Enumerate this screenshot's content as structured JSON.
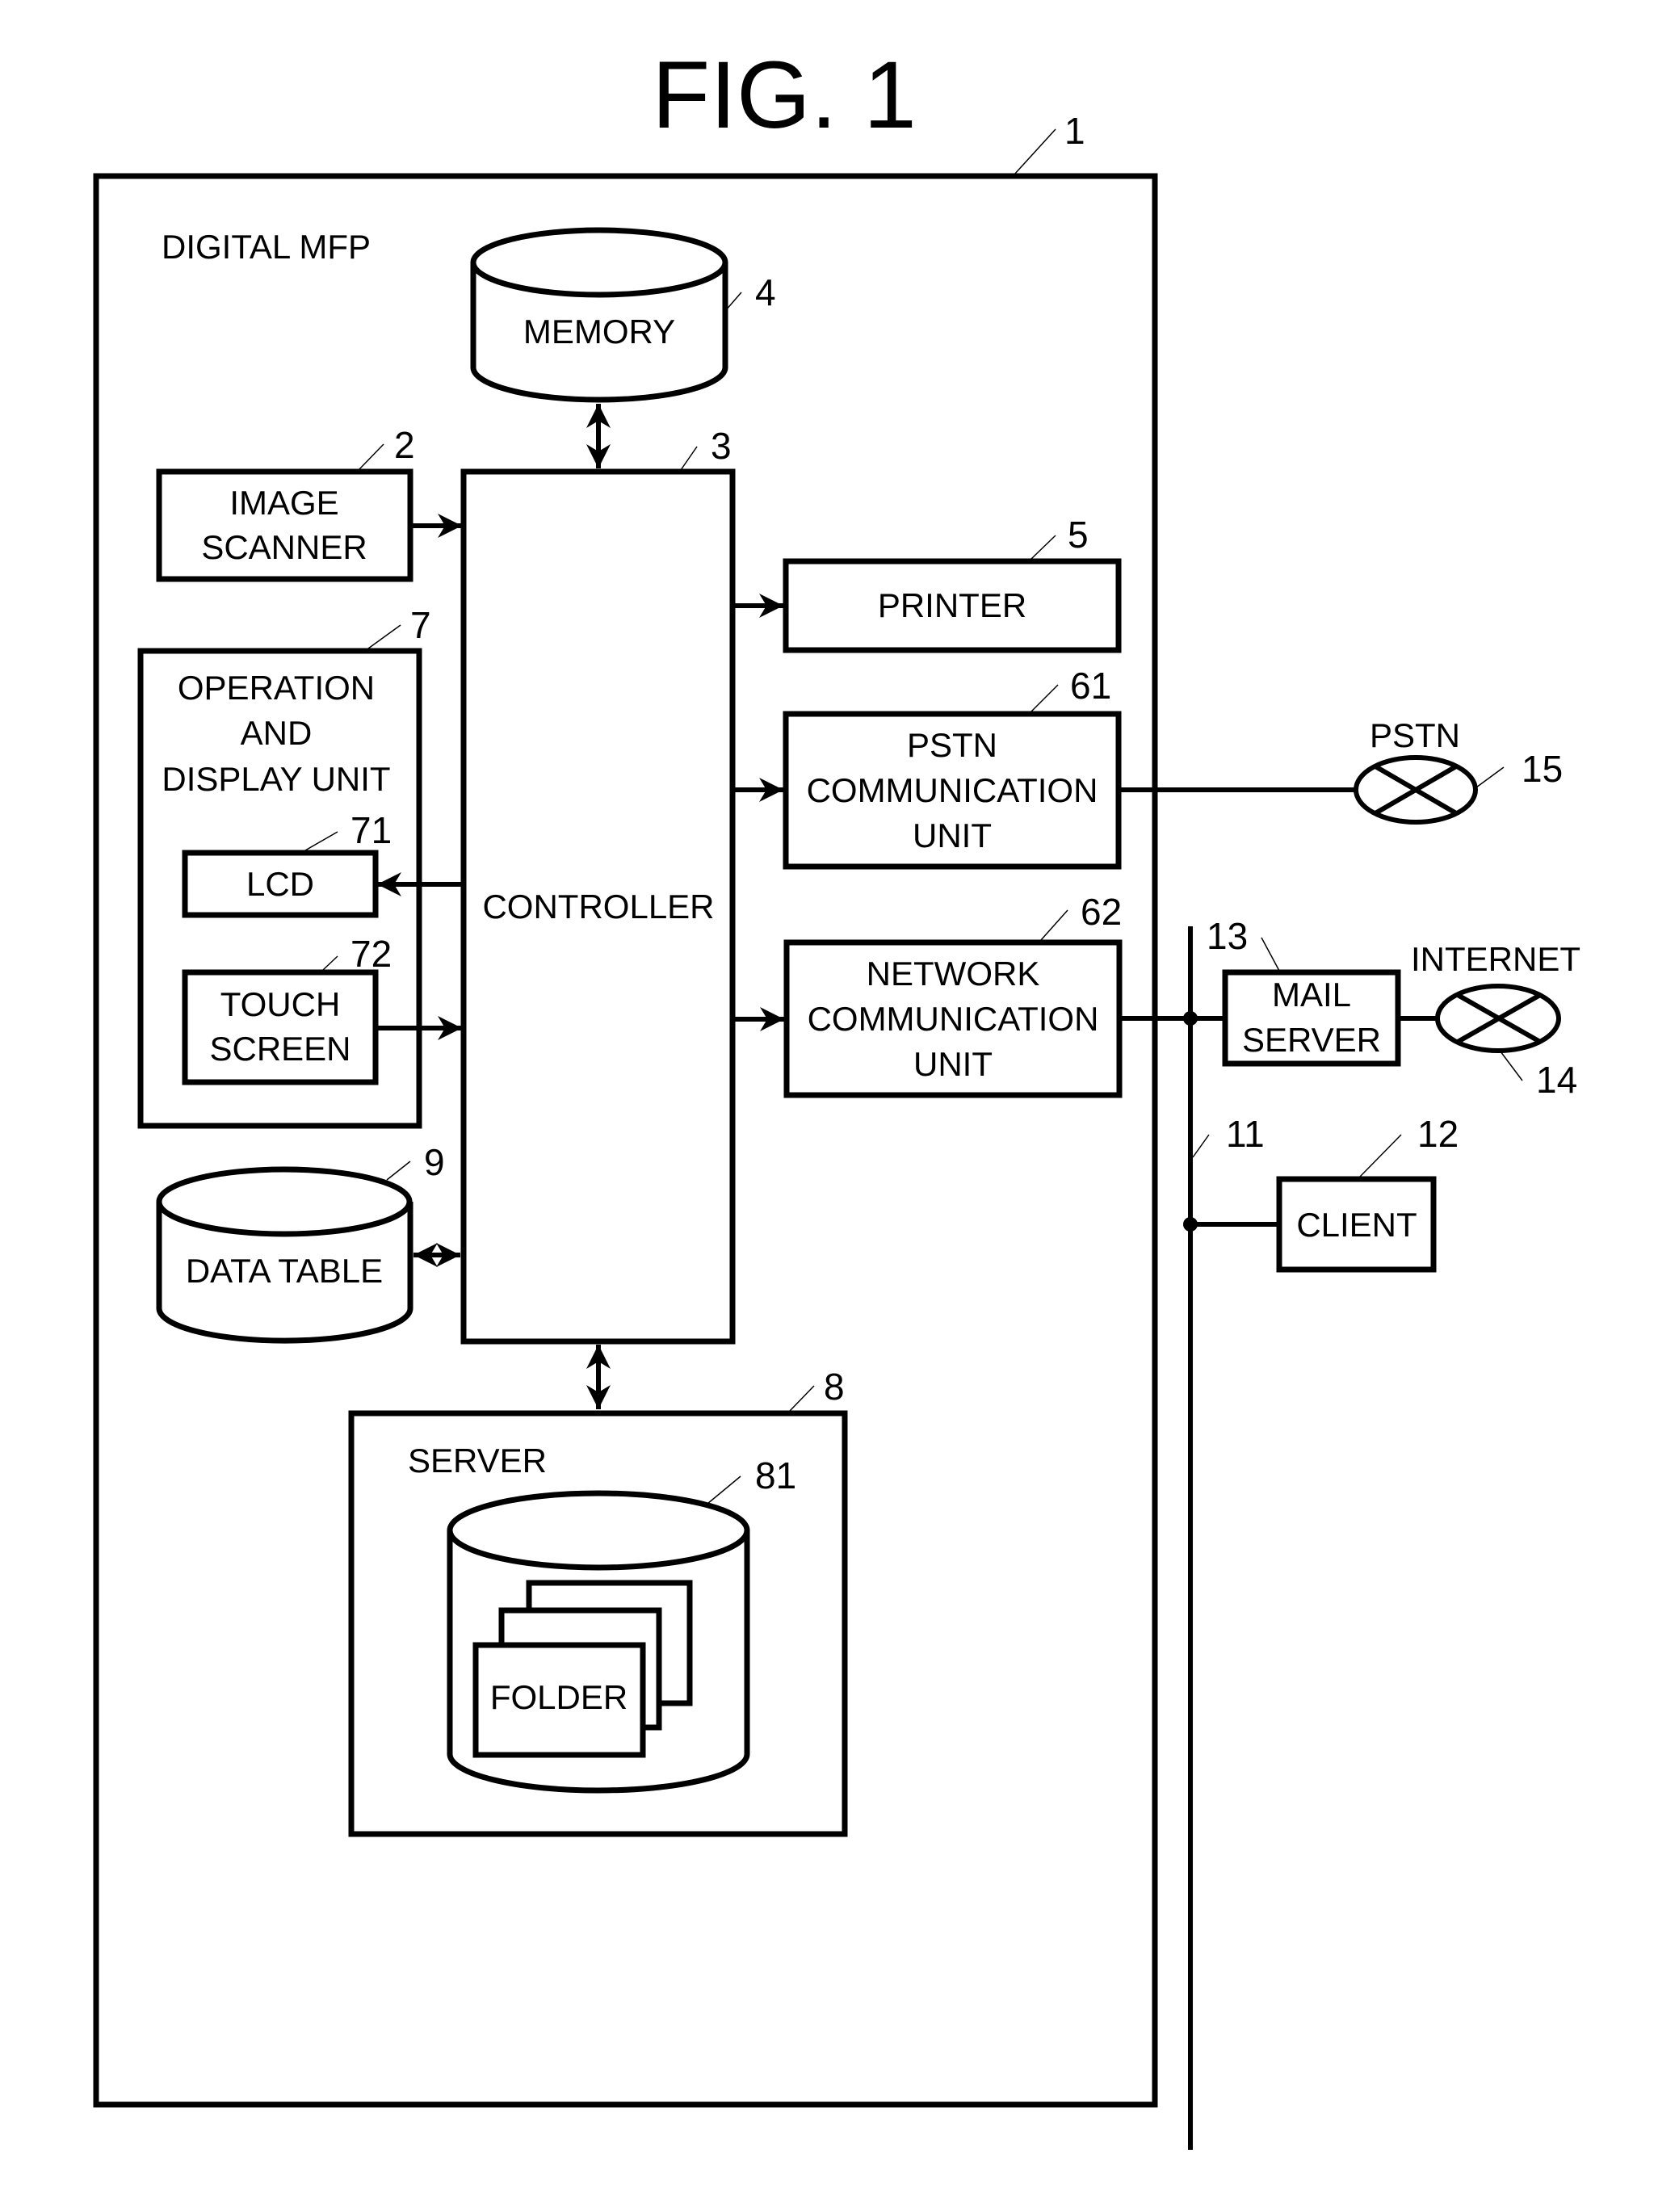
{
  "figure": {
    "title": "FIG. 1"
  },
  "mfp": {
    "ref": "1",
    "label": "DIGITAL MFP"
  },
  "components": {
    "memory": {
      "ref": "4",
      "label": "MEMORY"
    },
    "image_scanner": {
      "ref": "2",
      "lines": [
        "IMAGE",
        "SCANNER"
      ]
    },
    "controller": {
      "ref": "3",
      "label": "CONTROLLER"
    },
    "printer": {
      "ref": "5",
      "label": "PRINTER"
    },
    "pstn_comm_unit": {
      "ref": "61",
      "lines": [
        "PSTN",
        "COMMUNICATION",
        "UNIT"
      ]
    },
    "network_comm_unit": {
      "ref": "62",
      "lines": [
        "NETWORK",
        "COMMUNICATION",
        "UNIT"
      ]
    },
    "operation_display_unit": {
      "ref": "7",
      "lines": [
        "OPERATION",
        "AND",
        "DISPLAY UNIT"
      ]
    },
    "lcd": {
      "ref": "71",
      "label": "LCD"
    },
    "touch_screen": {
      "ref": "72",
      "lines": [
        "TOUCH",
        "SCREEN"
      ]
    },
    "data_table": {
      "ref": "9",
      "label": "DATA TABLE"
    },
    "server": {
      "ref": "8",
      "label": "SERVER"
    },
    "server_storage": {
      "ref": "81"
    },
    "folder": {
      "label": "FOLDER"
    }
  },
  "external": {
    "pstn": {
      "ref": "15",
      "label": "PSTN"
    },
    "lan": {
      "ref": "11"
    },
    "mail_server": {
      "ref": "13",
      "lines": [
        "MAIL",
        "SERVER"
      ]
    },
    "internet": {
      "ref": "14",
      "label": "INTERNET"
    },
    "client": {
      "ref": "12",
      "label": "CLIENT"
    }
  }
}
